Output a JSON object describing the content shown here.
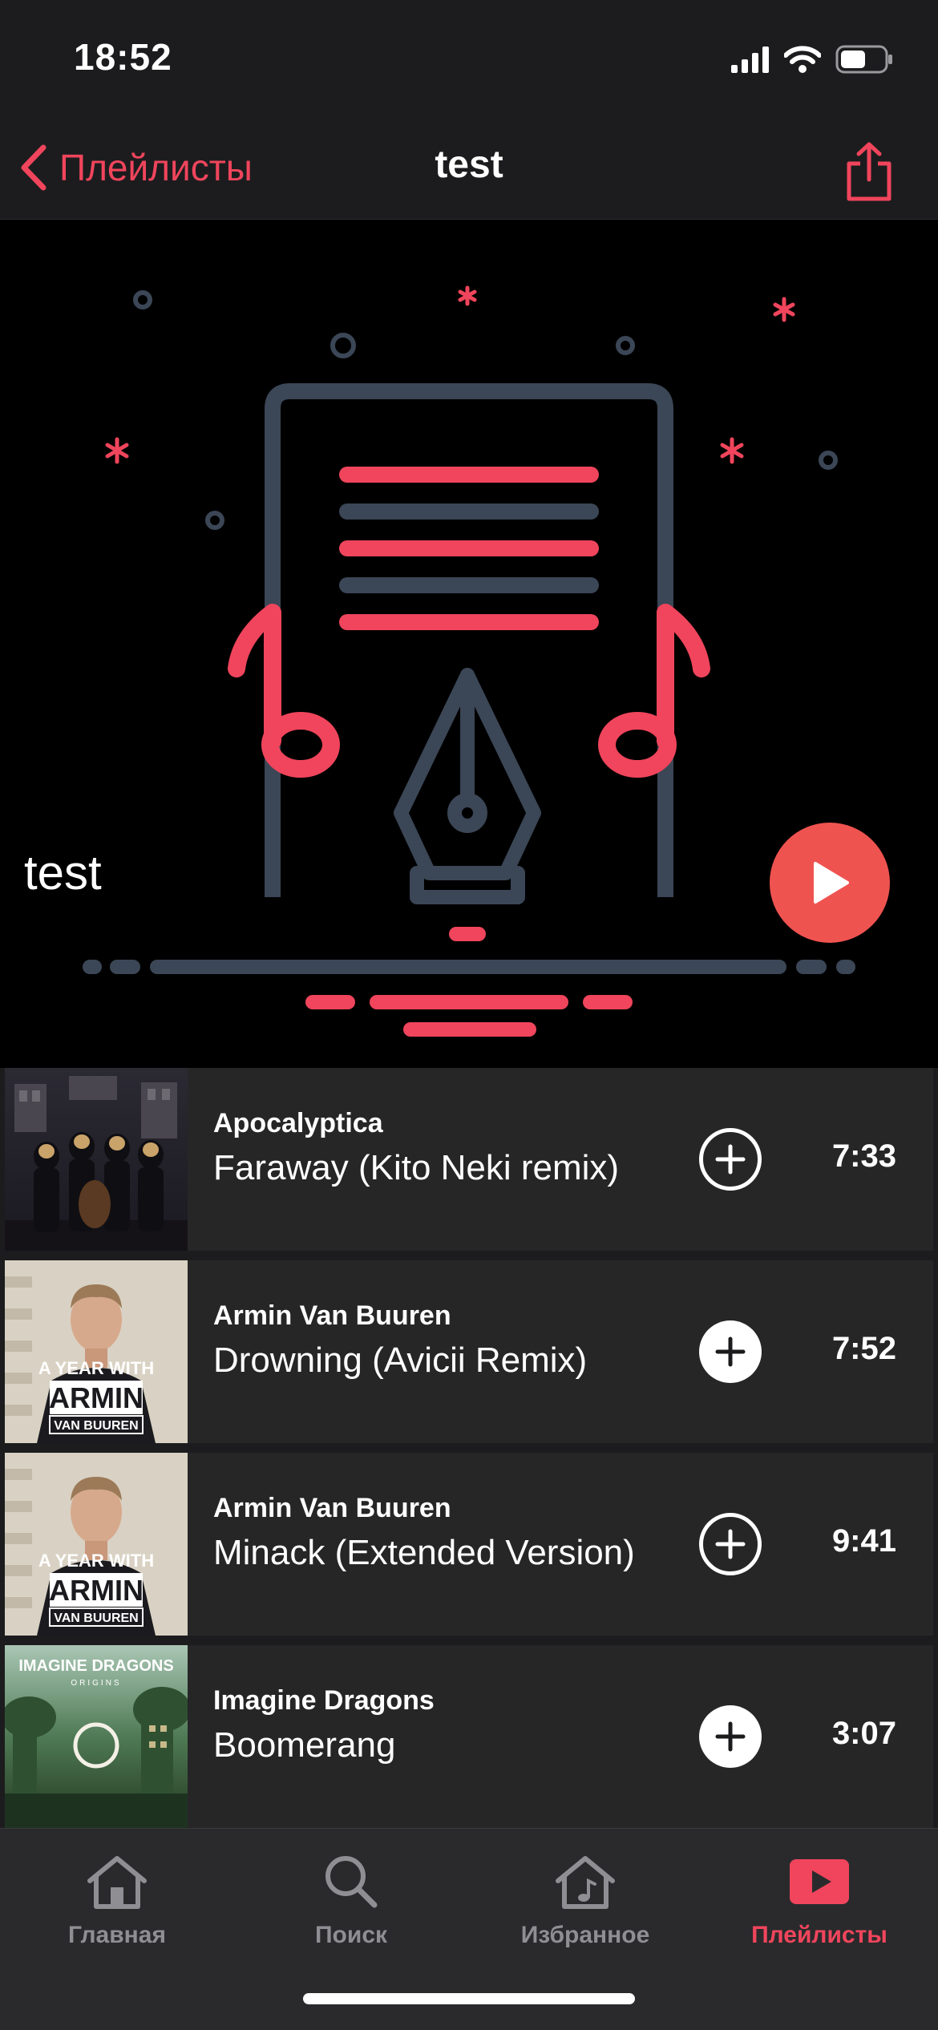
{
  "status_bar": {
    "time": "18:52"
  },
  "nav": {
    "back_label": "Плейлисты",
    "title": "test",
    "icons": {
      "back": "chevron-left-icon",
      "share": "share-icon"
    }
  },
  "playlist": {
    "title": "test",
    "colors": {
      "accent": "#f0455c",
      "play": "#ef5350",
      "outline": "#3b4656"
    }
  },
  "tracks": [
    {
      "artist": "Apocalyptica",
      "name": "Faraway (Kito Neki remix)",
      "duration": "7:33",
      "added": false
    },
    {
      "artist": "Armin Van Buuren",
      "name": "Drowning (Avicii Remix)",
      "duration": "7:52",
      "added": true
    },
    {
      "artist": "Armin Van Buuren",
      "name": "Minack (Extended Version)",
      "duration": "9:41",
      "added": false
    },
    {
      "artist": "Imagine Dragons",
      "name": "Boomerang",
      "duration": "3:07",
      "added": true
    }
  ],
  "covers": {
    "armin_line1": "A YEAR WITH",
    "armin_line2": "ARMIN",
    "armin_line3": "VAN BUUREN",
    "imagine_line1": "IMAGINE DRAGONS",
    "imagine_line2": "ORIGINS"
  },
  "tabs": [
    {
      "label": "Главная",
      "icon": "home-icon",
      "active": false
    },
    {
      "label": "Поиск",
      "icon": "search-icon",
      "active": false
    },
    {
      "label": "Избранное",
      "icon": "music-house-icon",
      "active": false
    },
    {
      "label": "Плейлисты",
      "icon": "playlist-play-icon",
      "active": true
    }
  ]
}
